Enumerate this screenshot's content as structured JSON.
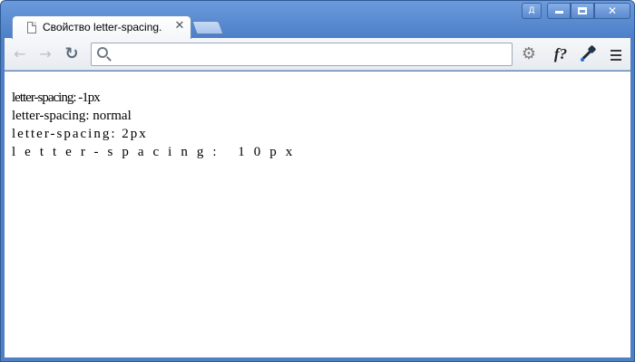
{
  "window": {
    "tab_title": "Свойство letter-spacing.",
    "tab_close": "✕",
    "user_button": "Д",
    "close_button": "✕"
  },
  "toolbar": {
    "back": "←",
    "forward": "→",
    "reload": "↻",
    "address": "",
    "address_placeholder": "",
    "gear": "⚙",
    "fx": "f?"
  },
  "content": {
    "lines": [
      "letter-spacing: -1px",
      "letter-spacing: normal",
      "letter-spacing: 2px",
      "letter-spacing: 10px"
    ]
  }
}
